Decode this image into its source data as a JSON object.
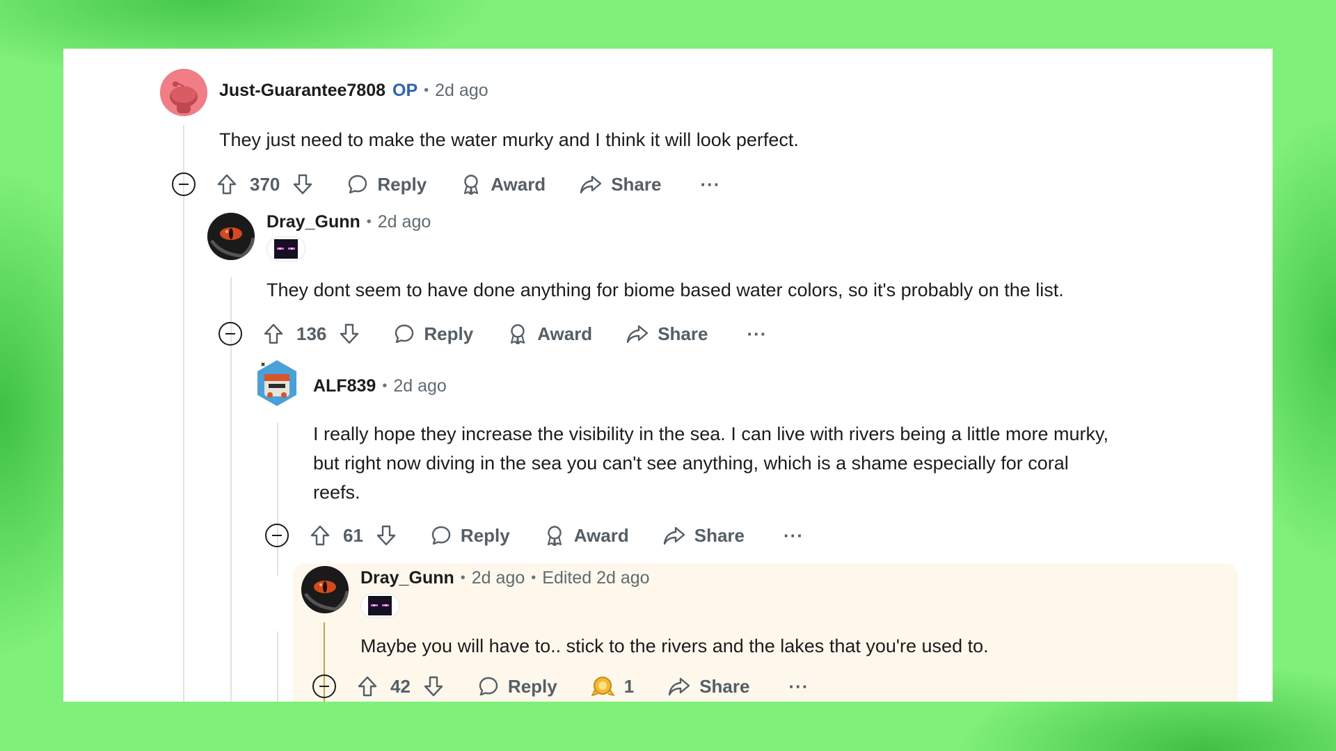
{
  "comments": [
    {
      "author": "Just-Guarantee7808",
      "op_badge": "OP",
      "time": "2d ago",
      "body": "They just need to make the water murky and I think it will look perfect.",
      "score": "370",
      "reply": "Reply",
      "award": "Award",
      "share": "Share",
      "more": "···",
      "avatar_color": "#f17d86"
    },
    {
      "author": "Dray_Gunn",
      "time": "2d ago",
      "body": "They dont seem to have done anything for biome based water colors, so it's probably on the list.",
      "score": "136",
      "reply": "Reply",
      "award": "Award",
      "share": "Share",
      "more": "···"
    },
    {
      "author": "ALF839",
      "time": "2d ago",
      "body_line1": "I really hope they increase the visibility in the sea. I can live with rivers being a little more murky,",
      "body_line2": "but right now diving in the sea you can't see anything, which is a shame especially for coral",
      "body_line3": "reefs.",
      "score": "61",
      "reply": "Reply",
      "award": "Award",
      "share": "Share",
      "more": "···"
    },
    {
      "author": "Dray_Gunn",
      "time": "2d ago",
      "edited": "Edited 2d ago",
      "body": "Maybe you will have to.. stick to the rivers and the lakes that you're used to.",
      "score": "42",
      "reply": "Reply",
      "award_count": "1",
      "share": "Share",
      "more": "···",
      "highlight_color": "#fdf7ec"
    }
  ],
  "colors": {
    "op": "#2a63b8",
    "thread_line": "#dfe3e6",
    "highlight_line": "#c9a24d",
    "award_gold": "#f5b82e"
  },
  "icons": [
    "upvote-icon",
    "downvote-icon",
    "comment-icon",
    "award-icon",
    "share-icon",
    "collapse-icon",
    "gold-award-icon",
    "enderman-flair-icon"
  ]
}
